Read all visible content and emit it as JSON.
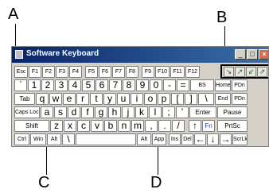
{
  "callouts": {
    "a": "A",
    "b": "B",
    "c": "C",
    "d": "D"
  },
  "window": {
    "title": "Software Keyboard",
    "minimize": "_",
    "maximize": "□",
    "close": "×"
  },
  "rows": {
    "fn": [
      "Esc",
      "F1",
      "F2",
      "F3",
      "F4",
      "F5",
      "F6",
      "F7",
      "F8",
      "F9",
      "F10",
      "F11",
      "F12"
    ],
    "num": [
      "`",
      "1",
      "2",
      "3",
      "4",
      "5",
      "6",
      "7",
      "8",
      "9",
      "0",
      "-",
      "=",
      "BS",
      "Home",
      "PDn"
    ],
    "qwe": [
      "Tab",
      "q",
      "w",
      "e",
      "r",
      "t",
      "y",
      "u",
      "i",
      "o",
      "p",
      "[",
      "]",
      "\\",
      "End",
      "PDn"
    ],
    "asd": [
      "Caps Lock",
      "a",
      "s",
      "d",
      "f",
      "g",
      "h",
      "j",
      "k",
      "l",
      ";",
      "'",
      "Enter",
      "Pause"
    ],
    "zxc": [
      "Shift",
      "z",
      "x",
      "c",
      "v",
      "b",
      "n",
      "m",
      ",",
      ".",
      "/",
      "↑",
      "Fn",
      "PrtSc"
    ],
    "bot": [
      "Ctrl",
      "Win",
      "Alt",
      "\\",
      "",
      "Alt",
      "App",
      "Ins",
      "Del",
      "←",
      "↓",
      "→",
      "ScrLk"
    ]
  },
  "tools": [
    "↘",
    "↗",
    "⇙",
    "⇗"
  ],
  "colors": {
    "title_start": "#0a246a",
    "title_end": "#3a6ea5",
    "close": "#d86b4c",
    "fn_blue": "#1a3fd0"
  }
}
